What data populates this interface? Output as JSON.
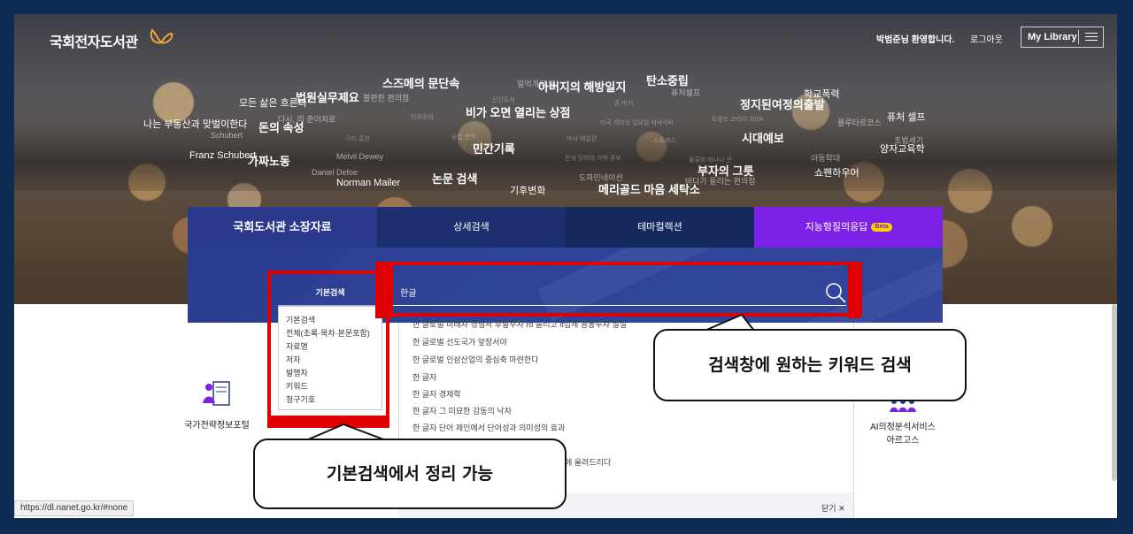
{
  "header": {
    "logo_text": "국회전자도서관",
    "welcome": "박범준님 환영합니다.",
    "logout": "로그아웃",
    "my_library": "My Library"
  },
  "word_cloud": [
    {
      "text": "스즈메의 문단속",
      "size": "l"
    },
    {
      "text": "일억개의 별",
      "size": "s"
    },
    {
      "text": "아버지의 해방일지",
      "size": "l"
    },
    {
      "text": "탄소중립",
      "size": "l"
    },
    {
      "text": "퓨처셀프",
      "size": "s"
    },
    {
      "text": "학교폭력",
      "size": "m"
    },
    {
      "text": "모든 삶은 흐른다",
      "size": "m"
    },
    {
      "text": "법원실무제요",
      "size": "l"
    },
    {
      "text": "불편한 편의점",
      "size": "s"
    },
    {
      "text": "신간도서",
      "size": "xs"
    },
    {
      "text": "존 버거",
      "size": "xs"
    },
    {
      "text": "정지된여정의출발",
      "size": "l"
    },
    {
      "text": "퓨처 셀프",
      "size": "m"
    },
    {
      "text": "나는 부동산과 맞벌이한다",
      "size": "m"
    },
    {
      "text": "돈의 속성",
      "size": "l"
    },
    {
      "text": "다시, 리 준이치로",
      "size": "s"
    },
    {
      "text": "민주주의",
      "size": "xs"
    },
    {
      "text": "비가 오면 열리는 상점",
      "size": "l"
    },
    {
      "text": "미국 레미의 일요일 저녁식탁",
      "size": "xs"
    },
    {
      "text": "트렌드 코리아 2024",
      "size": "xs"
    },
    {
      "text": "플루타르코스",
      "size": "s"
    },
    {
      "text": "Schubert",
      "size": "s"
    },
    {
      "text": "구리 홍청",
      "size": "xs"
    },
    {
      "text": "유럽 문학",
      "size": "xs"
    },
    {
      "text": "민간기록",
      "size": "l"
    },
    {
      "text": "박사 웨일전",
      "size": "xs"
    },
    {
      "text": "스트레스",
      "size": "xs"
    },
    {
      "text": "시대예보",
      "size": "l"
    },
    {
      "text": "초법세기",
      "size": "s"
    },
    {
      "text": "양자교육학",
      "size": "m"
    },
    {
      "text": "Franz Schubert",
      "size": "m"
    },
    {
      "text": "가짜노동",
      "size": "l"
    },
    {
      "text": "Melvil Dewey",
      "size": "s"
    },
    {
      "text": "돈과 당자의 가락 광부",
      "size": "xs"
    },
    {
      "text": "물류와 바나나 콘",
      "size": "xs"
    },
    {
      "text": "아동학대",
      "size": "s"
    },
    {
      "text": "Daniel Defoe",
      "size": "s"
    },
    {
      "text": "부자의 그릇",
      "size": "l"
    },
    {
      "text": "쇼펜하우어",
      "size": "m"
    },
    {
      "text": "논문 검색",
      "size": "l"
    },
    {
      "text": "도파민네이션",
      "size": "s"
    },
    {
      "text": "바다가 들리는 편의점",
      "size": "s"
    },
    {
      "text": "Norman Mailer",
      "size": "m"
    },
    {
      "text": "기후변화",
      "size": "m"
    },
    {
      "text": "메리골드 마음 세탁소",
      "size": "l"
    }
  ],
  "tabs": [
    {
      "label": "국회도서관 소장자료"
    },
    {
      "label": "상세검색"
    },
    {
      "label": "테마컬렉션"
    },
    {
      "label": "지능형질의응답",
      "badge": "Beta"
    }
  ],
  "search": {
    "scope_selected": "기본검색",
    "value": "한글",
    "scope_options": [
      "기본검색",
      "전체(초록·목차·본문포함)",
      "자료명",
      "저자",
      "발행자",
      "키워드",
      "청구기호"
    ]
  },
  "suggestions": [
    "한 글로벌 미래차 경쟁서 후발주자 rd 늘리고 it업체 공동투자 절실",
    "한 글로벌 선도국가 앞장서야",
    "한 글로벌 인삼산업의 중심축 마련한다",
    "한 글자",
    "한 글자 경제학",
    "한 글자 그 미묘한 감동의 낙차",
    "한 글자 단어 제인에서 단어성과 의미성의 효과",
    "에 올려드리다"
  ],
  "suggestions_close": "닫기",
  "services": {
    "left": "국가전략정보포털",
    "right_line1": "AI의정분석서비스",
    "right_line2": "아르고스"
  },
  "status_url": "https://dl.nanet.go.kr/#none",
  "annotations": {
    "right": "검색창에 원하는 키워드 검색",
    "left": "기본검색에서 정리 가능"
  },
  "colors": {
    "page_border": "#0d2a52",
    "tab_primary": "#2b3a8d",
    "tab_ai": "#7b22e6",
    "highlight": "#e00000"
  }
}
